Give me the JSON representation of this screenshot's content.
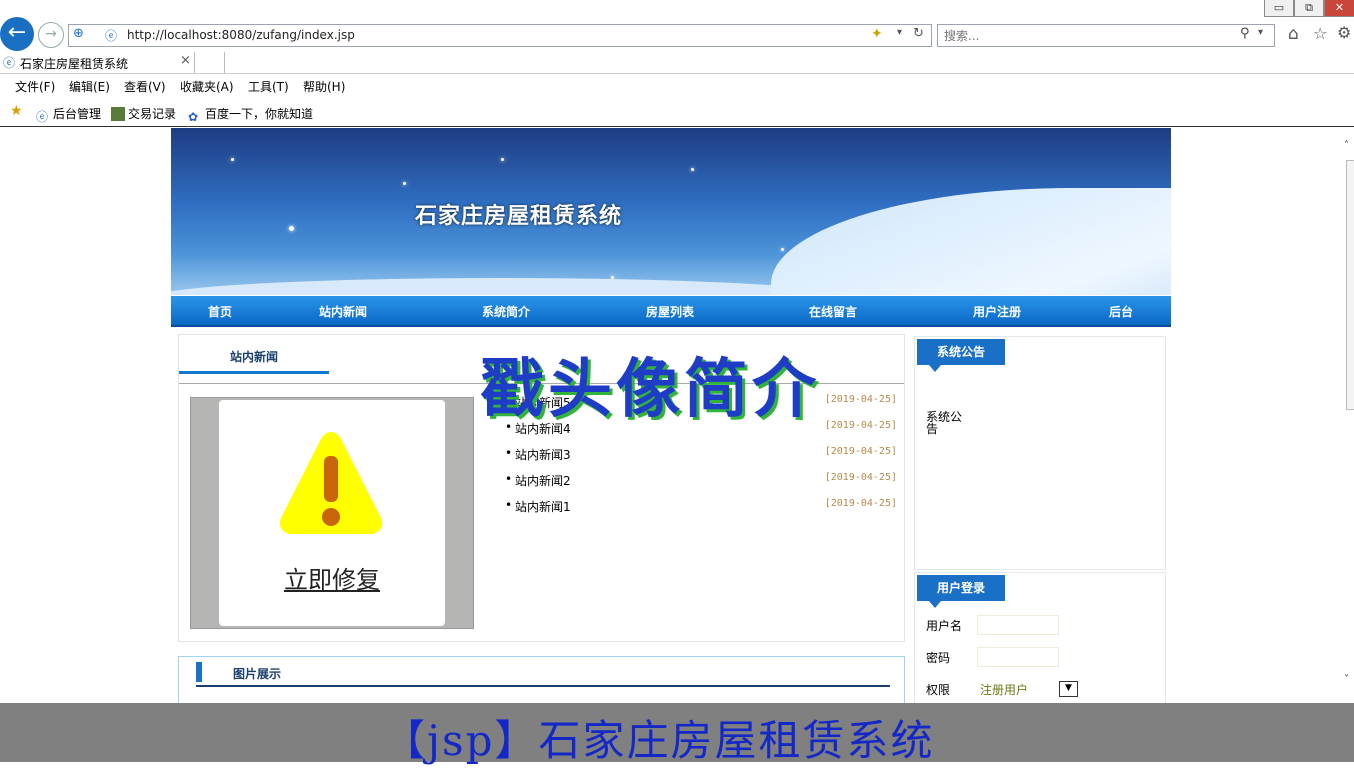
{
  "browser": {
    "url": "http://localhost:8080/zufang/index.jsp",
    "search_placeholder": "搜索...",
    "tab_title": "石家庄房屋租赁系统",
    "tab_close": "×",
    "menu": [
      "文件(F)",
      "编辑(E)",
      "查看(V)",
      "收藏夹(A)",
      "工具(T)",
      "帮助(H)"
    ],
    "favorites": [
      "后台管理",
      "交易记录",
      "百度一下，你就知道"
    ]
  },
  "site": {
    "banner_title": "石家庄房屋租赁系统",
    "nav": [
      "首页",
      "站内新闻",
      "系统简介",
      "房屋列表",
      "在线留言",
      "用户注册",
      "后台"
    ],
    "news_tab": "站内新闻",
    "repair_link": "立即修复",
    "news": [
      {
        "title": "站内新闻5",
        "date": "[2019-04-25]"
      },
      {
        "title": "站内新闻4",
        "date": "[2019-04-25]"
      },
      {
        "title": "站内新闻3",
        "date": "[2019-04-25]"
      },
      {
        "title": "站内新闻2",
        "date": "[2019-04-25]"
      },
      {
        "title": "站内新闻1",
        "date": "[2019-04-25]"
      }
    ],
    "notice_tab": "系统公告",
    "notice_text": "系统公告",
    "login_tab": "用户登录",
    "login": {
      "username_label": "用户名",
      "password_label": "密码",
      "role_label": "权限",
      "role_value": "注册用户"
    },
    "gallery_title": "图片展示"
  },
  "overlay_title": "戳头像简介",
  "footer_caption": "【jsp】石家庄房屋租赁系统",
  "colors": {
    "nav_blue": "#0a68c5",
    "overlay_blue": "#1e3cc6",
    "overlay_shadow": "#32b43a",
    "footer_gray": "#808080"
  }
}
